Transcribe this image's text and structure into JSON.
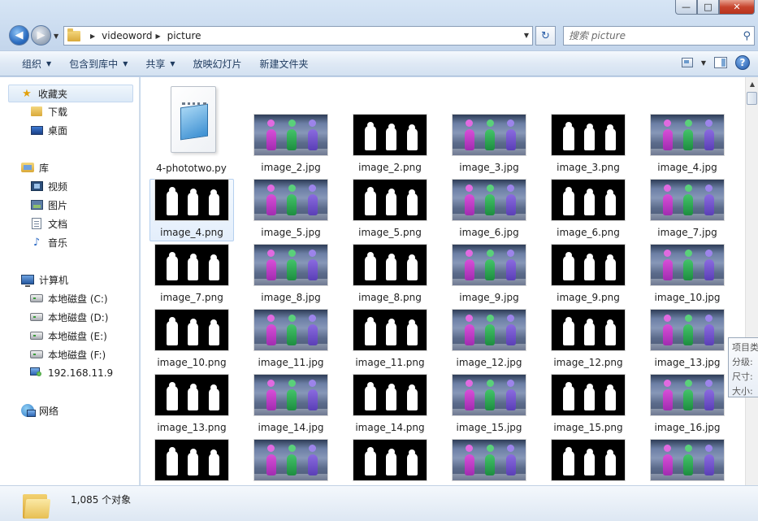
{
  "window": {
    "min": "—",
    "max": "□",
    "close": "✕"
  },
  "address": {
    "crumbs": [
      "videoword",
      "picture"
    ]
  },
  "search": {
    "placeholder": "搜索 picture"
  },
  "toolbar": {
    "organize": "组织",
    "include": "包含到库中",
    "share": "共享",
    "slideshow": "放映幻灯片",
    "newfolder": "新建文件夹"
  },
  "nav": {
    "favorites": "收藏夹",
    "downloads": "下载",
    "desktop": "桌面",
    "libraries": "库",
    "videos": "视频",
    "pictures": "图片",
    "documents": "文档",
    "music": "音乐",
    "computer": "计算机",
    "disk_c": "本地磁盘 (C:)",
    "disk_d": "本地磁盘 (D:)",
    "disk_e": "本地磁盘 (E:)",
    "disk_f": "本地磁盘 (F:)",
    "net_ip": "192.168.11.9",
    "network": "网络"
  },
  "files": [
    {
      "name": "4-phototwo.py",
      "type": "py"
    },
    {
      "name": "image_2.jpg",
      "type": "jpg"
    },
    {
      "name": "image_2.png",
      "type": "png"
    },
    {
      "name": "image_3.jpg",
      "type": "jpg"
    },
    {
      "name": "image_3.png",
      "type": "png"
    },
    {
      "name": "image_4.jpg",
      "type": "jpg"
    },
    {
      "name": "image_4.png",
      "type": "png",
      "selected": true
    },
    {
      "name": "image_5.jpg",
      "type": "jpg"
    },
    {
      "name": "image_5.png",
      "type": "png"
    },
    {
      "name": "image_6.jpg",
      "type": "jpg"
    },
    {
      "name": "image_6.png",
      "type": "png"
    },
    {
      "name": "image_7.jpg",
      "type": "jpg"
    },
    {
      "name": "image_7.png",
      "type": "png"
    },
    {
      "name": "image_8.jpg",
      "type": "jpg"
    },
    {
      "name": "image_8.png",
      "type": "png"
    },
    {
      "name": "image_9.jpg",
      "type": "jpg"
    },
    {
      "name": "image_9.png",
      "type": "png"
    },
    {
      "name": "image_10.jpg",
      "type": "jpg"
    },
    {
      "name": "image_10.png",
      "type": "png"
    },
    {
      "name": "image_11.jpg",
      "type": "jpg"
    },
    {
      "name": "image_11.png",
      "type": "png"
    },
    {
      "name": "image_12.jpg",
      "type": "jpg"
    },
    {
      "name": "image_12.png",
      "type": "png"
    },
    {
      "name": "image_13.jpg",
      "type": "jpg"
    },
    {
      "name": "image_13.png",
      "type": "png"
    },
    {
      "name": "image_14.jpg",
      "type": "jpg"
    },
    {
      "name": "image_14.png",
      "type": "png"
    },
    {
      "name": "image_15.jpg",
      "type": "jpg"
    },
    {
      "name": "image_15.png",
      "type": "png"
    },
    {
      "name": "image_16.jpg",
      "type": "jpg"
    },
    {
      "name": "",
      "type": "png"
    },
    {
      "name": "",
      "type": "jpg"
    },
    {
      "name": "",
      "type": "png"
    },
    {
      "name": "",
      "type": "jpg"
    },
    {
      "name": "",
      "type": "png"
    },
    {
      "name": "",
      "type": "jpg"
    }
  ],
  "tooltip": {
    "line1": "项目类",
    "line2": "分级:",
    "line3": "尺寸:",
    "line4": "大小:"
  },
  "status": {
    "count": "1,085 个对象"
  }
}
